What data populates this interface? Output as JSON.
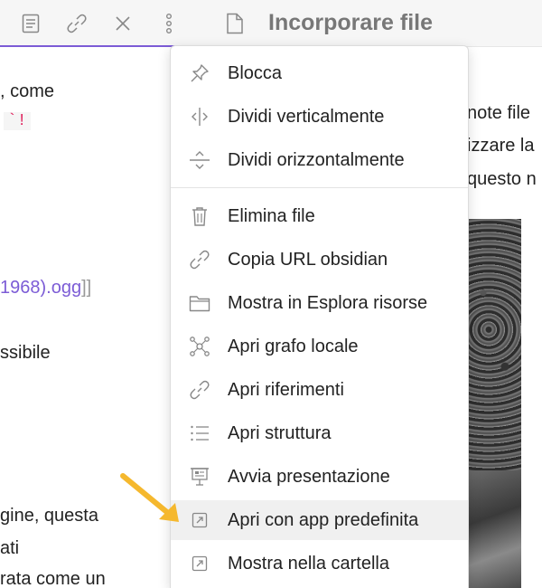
{
  "left_pane": {
    "toolbar_icons": [
      "reading-view-icon",
      "link-icon",
      "close-icon",
      "more-options-icon"
    ],
    "text_lines": [
      ", come",
      "1968).ogg",
      "]]",
      "ssibile",
      "gine, questa",
      "ati",
      "rata come un"
    ],
    "code_fragment": "`!"
  },
  "right_pane": {
    "title": "Incorporare file",
    "text_lines": [
      "note file",
      "izzare la",
      "questo n"
    ]
  },
  "context_menu": {
    "items": [
      {
        "label": "Blocca",
        "icon": "pin-icon"
      },
      {
        "label": "Dividi verticalmente",
        "icon": "split-vertical-icon"
      },
      {
        "label": "Dividi orizzontalmente",
        "icon": "split-horizontal-icon"
      },
      {
        "label": "Elimina file",
        "icon": "trash-icon"
      },
      {
        "label": "Copia URL obsidian",
        "icon": "link-icon"
      },
      {
        "label": "Mostra in Esplora risorse",
        "icon": "folder-icon"
      },
      {
        "label": "Apri grafo locale",
        "icon": "graph-icon"
      },
      {
        "label": "Apri riferimenti",
        "icon": "link-icon"
      },
      {
        "label": "Apri struttura",
        "icon": "list-icon"
      },
      {
        "label": "Avvia presentazione",
        "icon": "presentation-icon"
      },
      {
        "label": "Apri con app predefinita",
        "icon": "open-external-icon",
        "highlighted": true
      },
      {
        "label": "Mostra nella cartella",
        "icon": "open-external-icon"
      }
    ]
  },
  "colors": {
    "accent": "#7c5cd6",
    "arrow": "#f5b82e",
    "link_text": "#7c5cd6",
    "code_text": "#e0245e"
  }
}
